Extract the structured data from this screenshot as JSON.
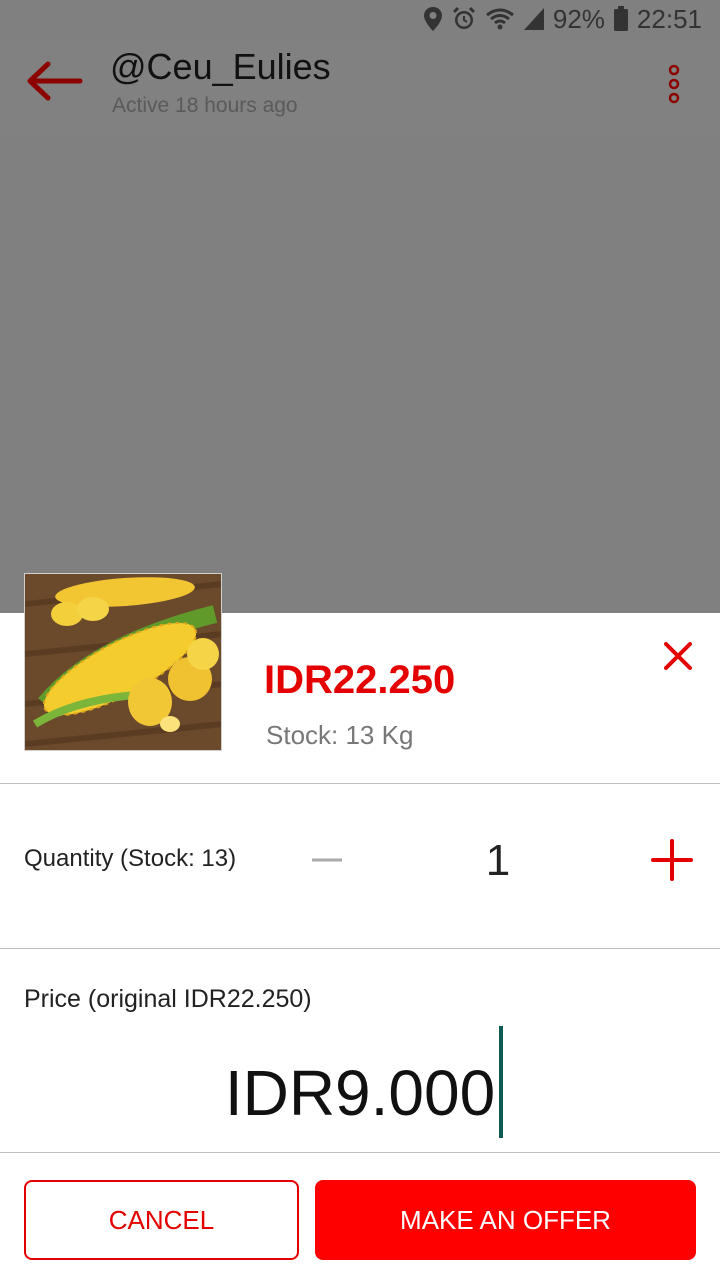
{
  "status_bar": {
    "battery": "92%",
    "time": "22:51",
    "icons": [
      "location-icon",
      "alarm-icon",
      "wifi-icon",
      "signal-icon",
      "battery-icon"
    ]
  },
  "header": {
    "username": "@Ceu_Eulies",
    "last_active": "Active 18 hours ago",
    "back_icon": "arrow-left-icon",
    "menu_icon": "more-vertical-icon"
  },
  "product": {
    "price": "IDR22.250",
    "stock": "Stock: 13 Kg",
    "close_icon": "close-icon"
  },
  "quantity": {
    "label": "Quantity (Stock: 13)",
    "value": "1"
  },
  "offer": {
    "label": "Price (original IDR22.250)",
    "value": "IDR9.000"
  },
  "buttons": {
    "cancel": "CANCEL",
    "make_offer": "MAKE AN OFFER"
  },
  "colors": {
    "accent": "#e50000",
    "primary_button": "#ff0000",
    "caret": "#0d5a55",
    "overlay": "#808080"
  }
}
